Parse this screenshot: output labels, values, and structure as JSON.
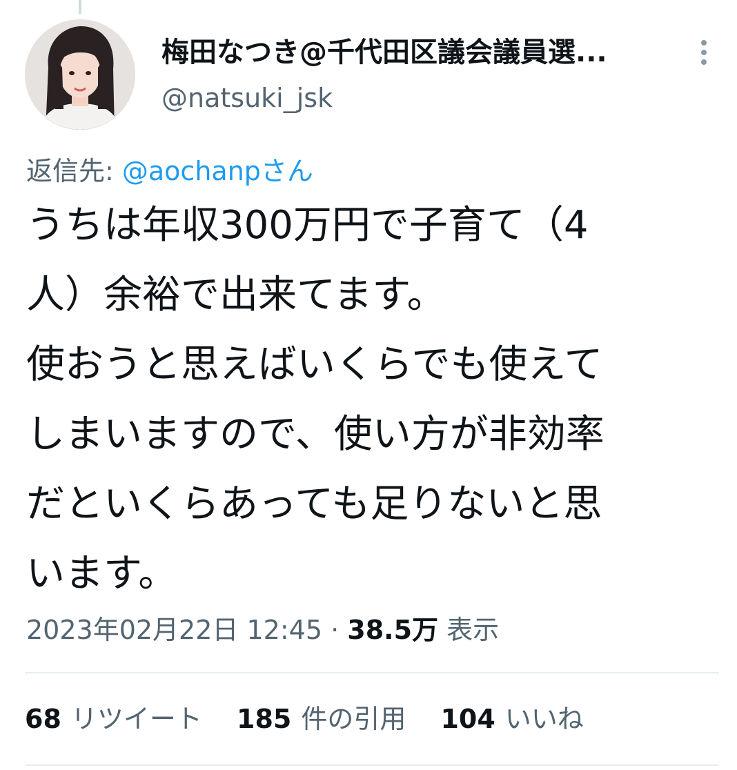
{
  "author": {
    "display_name": "梅田なつき@千代田区議会議員選...",
    "handle": "@natsuki_jsk"
  },
  "reply": {
    "prefix": "返信先: ",
    "mention": "@aochanpさん"
  },
  "tweet": {
    "lines": [
      "うちは年収300万円で子育て（4",
      "人）余裕で出来てます。",
      "使おうと思えばいくらでも使えて",
      "しまいますので、使い方が非効率",
      "だといくらあっても足りないと思",
      "います。"
    ]
  },
  "meta": {
    "timestamp": "2023年02月22日 12:45",
    "separator": " · ",
    "views_count": "38.5万",
    "views_label": "表示"
  },
  "stats": {
    "retweets": {
      "count": "68",
      "label": "リツイート"
    },
    "quotes": {
      "count": "185",
      "label": "件の引用"
    },
    "likes": {
      "count": "104",
      "label": "いいね"
    }
  },
  "icons": {
    "more": "more-vertical-icon"
  },
  "colors": {
    "text_primary": "#0f1419",
    "text_secondary": "#536471",
    "link": "#1d9bf0",
    "divider": "#e7ecef"
  }
}
